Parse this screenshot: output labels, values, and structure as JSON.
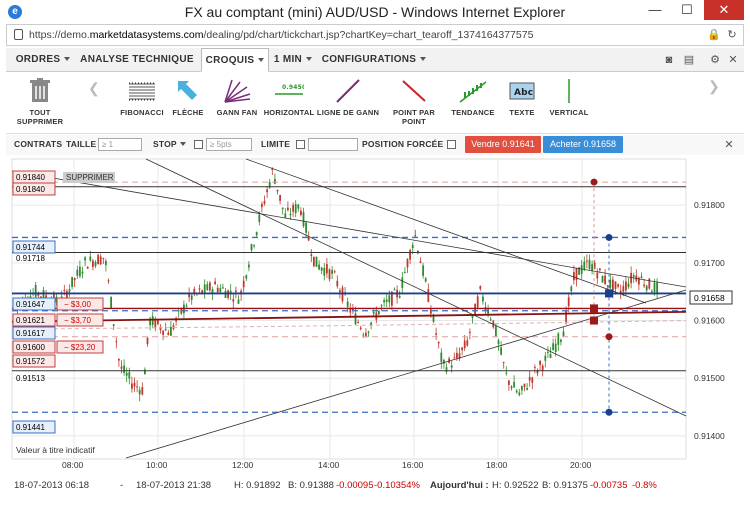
{
  "window": {
    "title": "FX au comptant (mini) AUD/USD - Windows Internet Explorer",
    "minimize": "—",
    "maximize": "☐",
    "close": "✕"
  },
  "address": {
    "prefix": "https://demo.",
    "domain": "marketdatasystems.com",
    "path": "/dealing/pd/chart/tickchart.jsp?chartKey=chart_tearoff_1374164377575"
  },
  "menu": {
    "items": [
      "ORDRES",
      "ANALYSE TECHNIQUE",
      "CROQUIS",
      "1 MIN",
      "CONFIGURATIONS"
    ],
    "active": "CROQUIS"
  },
  "tools": {
    "delete_all": "TOUT SUPPRIMER",
    "items": [
      "FIBONACCI",
      "FLÈCHE",
      "GANN FAN",
      "HORIZONTAL",
      "LIGNE DE GANN",
      "POINT PAR POINT",
      "TENDANCE",
      "TEXTE",
      "VERTICAL"
    ],
    "horizontal_value": "0.9450",
    "text_icon": "Abc"
  },
  "orderbar": {
    "contrats": "CONTRATS",
    "taille": "TAILLE",
    "taille_placeholder": "≥ 1",
    "stop": "STOP",
    "stop_placeholder": "≥ 5pts",
    "limite": "LIMITE",
    "position_forcee": "POSITION FORCÉE",
    "sell": "Vendre 0.91641",
    "buy": "Acheter 0.91658"
  },
  "chart_data": {
    "type": "candlestick",
    "instrument": "AUD/USD",
    "x_ticks": [
      "08:00",
      "10:00",
      "12:00",
      "14:00",
      "16:00",
      "18:00",
      "20:00"
    ],
    "y_ticks": [
      "0.91800",
      "0.91700",
      "0.91600",
      "0.91500",
      "0.91400"
    ],
    "ylim": [
      0.9136,
      0.9188
    ],
    "last_price": "0.91658",
    "footnote": "Valeur à titre indicatif",
    "supprimer": "SUPPRIMER",
    "left_labels": [
      {
        "value": "0.91840",
        "style": "red"
      },
      {
        "value": "0.91840",
        "style": "red"
      },
      {
        "value": "0.91744",
        "style": "blue"
      },
      {
        "value": "0.91718",
        "style": "plain"
      },
      {
        "value": "0.91647",
        "style": "blue"
      },
      {
        "value": "0.91621",
        "style": "red"
      },
      {
        "value": "0.91617",
        "style": "blue"
      },
      {
        "value": "0.91600",
        "style": "red"
      },
      {
        "value": "0.91572",
        "style": "red"
      },
      {
        "value": "0.91513",
        "style": "plain"
      },
      {
        "value": "0.91441",
        "style": "blue"
      }
    ],
    "pnl_tags": [
      {
        "text": "− $3,00"
      },
      {
        "text": "− $3,70"
      },
      {
        "text": "− $23,20"
      }
    ]
  },
  "status": {
    "range_start": "18-07-2013 06:18",
    "dash": "-",
    "range_end": "18-07-2013 21:38",
    "high": "H: 0.91892",
    "low": "B: 0.91388",
    "chg": "-0.00095",
    "chg_pct": "-0.10354%",
    "today_label": "Aujourd'hui :",
    "today_high": "H: 0.92522",
    "today_low": "B: 0.91375",
    "today_chg": "-0.00735",
    "today_pct": "-0.8%"
  }
}
